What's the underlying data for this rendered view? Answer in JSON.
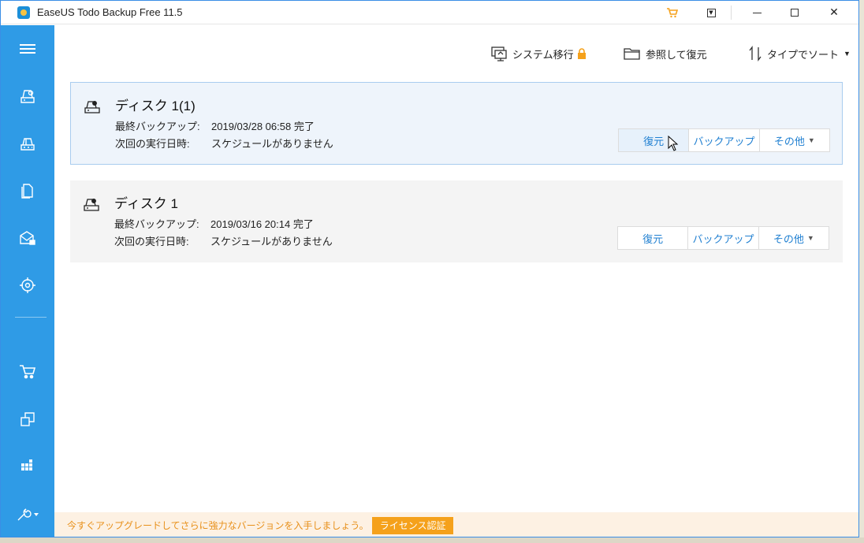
{
  "window": {
    "title": "EaseUS Todo Backup Free 11.5"
  },
  "titlebar": {
    "cart_icon": "cart-icon",
    "menu_icon": "dropdown-menu-icon",
    "minimize_icon": "minimize-icon",
    "maximize_icon": "maximize-icon",
    "close_icon": "close-icon",
    "close_glyph": "✕"
  },
  "sidebar": {
    "items": [
      {
        "icon": "hamburger-menu-icon"
      },
      {
        "icon": "disk-backup-icon"
      },
      {
        "icon": "partition-backup-icon"
      },
      {
        "icon": "file-backup-icon"
      },
      {
        "icon": "mail-backup-icon"
      },
      {
        "icon": "smart-backup-icon"
      },
      {
        "icon": "cart-icon"
      },
      {
        "icon": "clone-icon"
      },
      {
        "icon": "apps-icon"
      },
      {
        "icon": "tools-icon"
      }
    ]
  },
  "toolbar": {
    "system_transfer": "システム移行",
    "browse_restore": "参照して復元",
    "sort_by_type": "タイプでソート"
  },
  "backups": [
    {
      "name": "ディスク 1(1)",
      "last_backup_label": "最終バックアップ:",
      "last_backup_value": "2019/03/28 06:58 完了",
      "next_run_label": "次回の実行日時:",
      "next_run_value": "スケジュールがありません",
      "restore": "復元",
      "backup": "バックアップ",
      "more": "その他"
    },
    {
      "name": "ディスク 1",
      "last_backup_label": "最終バックアップ:",
      "last_backup_value": "2019/03/16 20:14 完了",
      "next_run_label": "次回の実行日時:",
      "next_run_value": "スケジュールがありません",
      "restore": "復元",
      "backup": "バックアップ",
      "more": "その他"
    }
  ],
  "footer": {
    "upgrade_text": "今すぐアップグレードしてさらに強力なバージョンを入手しましょう。",
    "license_button": "ライセンス認証"
  },
  "colors": {
    "sidebar": "#2f9be6",
    "accent": "#1f7fd1",
    "orange": "#f5a11b"
  }
}
